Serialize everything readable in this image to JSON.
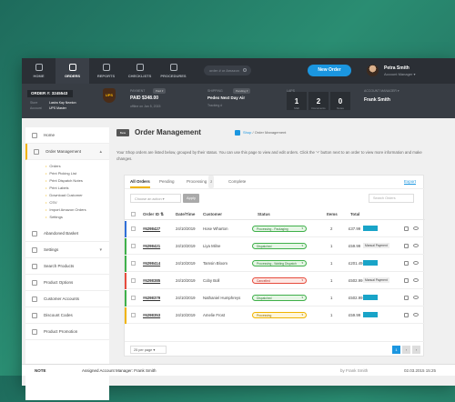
{
  "topnav": [
    {
      "label": "HOME",
      "icon": "home-icon"
    },
    {
      "label": "ORDERS",
      "icon": "orders-icon"
    },
    {
      "label": "REPORTS",
      "icon": "reports-icon"
    },
    {
      "label": "CHECKLISTS",
      "icon": "checklist-icon"
    },
    {
      "label": "PROCEDURES",
      "icon": "gear-icon"
    }
  ],
  "search": {
    "placeholder": "order # or Amazon"
  },
  "new_order": "New Order",
  "user": {
    "name": "Petra Smith",
    "role": "Account Manager ▾"
  },
  "order_bar": {
    "order_number": "ORDER #: 3245543",
    "store_label": "Store",
    "store_value": "Lastra Kay Newton",
    "account_label": "Account",
    "account_value": "UPS Master",
    "carrier_logo": "UPS",
    "payment_label": "PAYMENT",
    "payment_status": "PAID $348.00",
    "payment_pill": "Paid ▾",
    "payment_date": "offline on Jan 5, 2015",
    "shipping_label": "SHIPPING",
    "shipping_pill": "Pending ▾",
    "shipping_method": "Pedex Next Day Air",
    "tracking": "Tracking #",
    "laps_label": "LAPS",
    "lanes": [
      {
        "n": "1",
        "l": "Mall"
      },
      {
        "n": "2",
        "l": "Documents"
      },
      {
        "n": "0",
        "l": "Notes"
      }
    ],
    "manager_label": "ACCOUNT MANAGER ▾",
    "manager_name": "Frank Smith"
  },
  "sidebar": {
    "items": [
      {
        "label": "Home"
      },
      {
        "label": "Order Management",
        "chev": "▴"
      },
      {
        "label": "Abandoned Basket"
      },
      {
        "label": "Settings",
        "chev": "▾"
      },
      {
        "label": "Search Products"
      },
      {
        "label": "Product Options"
      },
      {
        "label": "Customer Accounts"
      },
      {
        "label": "Discount Codes"
      },
      {
        "label": "Product Promotion"
      }
    ],
    "sub": [
      "Orders",
      "Print Picking List",
      "Print Dispatch Notes",
      "Print Labels",
      "Download Customer",
      "CSV",
      "Import Amazon Orders",
      "Settings"
    ]
  },
  "main": {
    "badge": "Beta",
    "title": "Order Management",
    "breadcrumb_shop": "Shop",
    "breadcrumb_sep": "/",
    "breadcrumb_current": "Order Management",
    "description": "Your Shop orders are listed below, grouped by their status. You can use this page to view and edit orders. Click the '+' button next to an order to view more information and make changes.",
    "tabs": [
      {
        "label": "All Orders"
      },
      {
        "label": "Pending"
      },
      {
        "label": "Processing",
        "count": "2"
      },
      {
        "label": "Complete"
      }
    ],
    "export": "Export",
    "bulk_select": "Choose an action ▾",
    "apply": "Apply",
    "search_orders": "Search Orders",
    "headers": {
      "order": "Order ID ⇅",
      "date": "Date/Time",
      "customer": "Customer",
      "status": "Status",
      "items": "Items",
      "total": "Total"
    },
    "rows": [
      {
        "id": "#6298427",
        "date": "24/10/2019",
        "customer": "Hose Wharton",
        "status": "Processing - Packaging",
        "items": "2",
        "total": "£37.99",
        "color": "#2f6fd8",
        "label": "barcode"
      },
      {
        "id": "#6298421",
        "date": "24/10/2019",
        "customer": "Liya Milne",
        "status": "Dispatched",
        "items": "1",
        "total": "£59.99",
        "color": "#3fb04a",
        "label": "manual",
        "manual": "Manual Payment"
      },
      {
        "id": "#6298414",
        "date": "24/10/2019",
        "customer": "Tamsin Bloom",
        "status": "Processing - Waiting Dispatch",
        "items": "1",
        "total": "£201.49",
        "color": "#3fb04a",
        "label": "barcode"
      },
      {
        "id": "#6298385",
        "date": "24/10/2019",
        "customer": "Coby Boll",
        "status": "Cancelled",
        "items": "1",
        "total": "£502.99",
        "color": "#e64b3c",
        "label": "manual",
        "manual": "Manual Payment"
      },
      {
        "id": "#6298379",
        "date": "24/10/2019",
        "customer": "Nathaniel Humphreys",
        "status": "Dispatched",
        "items": "1",
        "total": "£502.99",
        "color": "#3fb04a",
        "label": "barcode"
      },
      {
        "id": "#6298353",
        "date": "24/10/2019",
        "customer": "Amelie Frost",
        "status": "Processing",
        "items": "1",
        "total": "£59.99",
        "color": "#f0b400",
        "label": "barcode"
      }
    ],
    "per_page": "25 per page ▾",
    "pages": [
      "1",
      "‹",
      "›"
    ]
  },
  "note": {
    "label": "NOTE",
    "text": "Assigned Account Manager: Frank Smith",
    "by": "by Frank Smith",
    "when": "02.03.2015 15:25"
  },
  "colors": {
    "accent": "#1b96e0",
    "highlight": "#f0b400",
    "dark": "#2b2f35"
  }
}
